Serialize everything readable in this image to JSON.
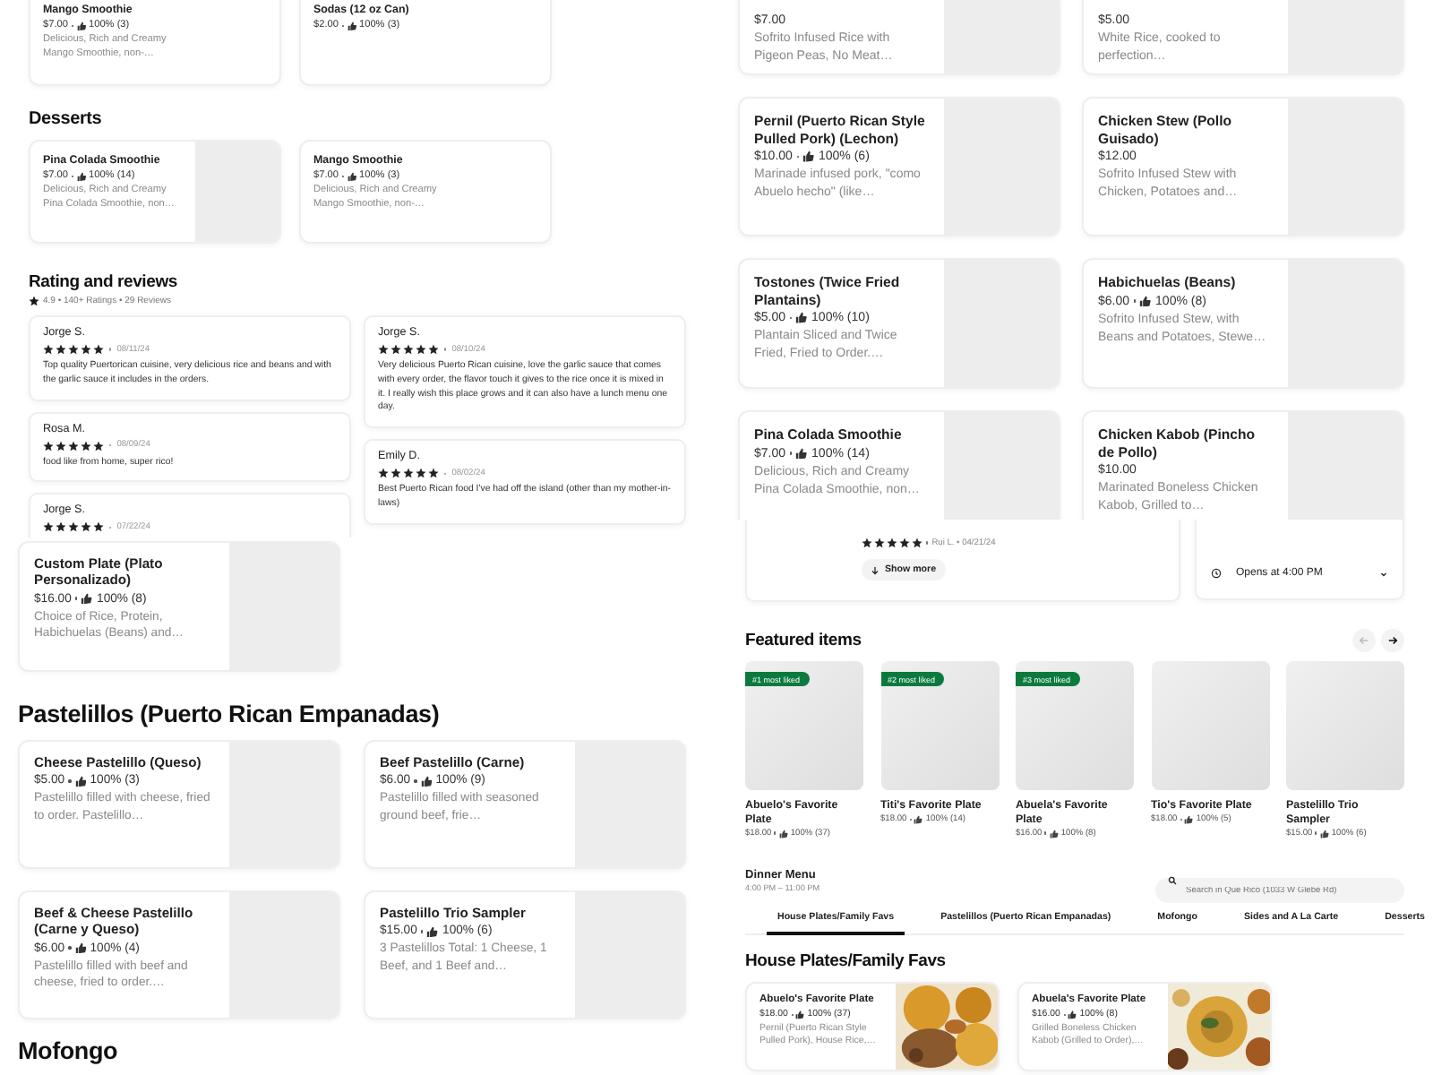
{
  "top_left": {
    "items": [
      {
        "name": "Mango Smoothie",
        "price": "$7.00",
        "rating": "100% (3)",
        "description": "Delicious, Rich and Creamy Mango Smoothie, non-…",
        "image": false
      },
      {
        "name": "Sodas (12 oz Can)",
        "price": "$2.00",
        "rating": "100% (3)",
        "image": false
      }
    ],
    "sections": [
      {
        "title": "Desserts",
        "items": [
          {
            "name": "Pina Colada Smoothie",
            "price": "$7.00",
            "rating": "100% (14)",
            "description": "Delicious, Rich and Creamy Pina Colada Smoothie, non…",
            "image": true
          },
          {
            "name": "Mango Smoothie",
            "price": "$7.00",
            "rating": "100% (3)",
            "description": "Delicious, Rich and Creamy Mango Smoothie, non-…",
            "image": false
          }
        ]
      }
    ],
    "reviews": {
      "title": "Rating and reviews",
      "summary": "4.9 • 140+ Ratings • 29 Reviews",
      "columns": [
        [
          {
            "author": "Jorge S.",
            "stars": 5,
            "date": "08/11/24",
            "text": "Top quality Puertorican cuisine, very delicious rice and beans and with the garlic sauce it includes in the orders."
          },
          {
            "author": "Rosa M.",
            "stars": 5,
            "date": "08/09/24",
            "text": "food like from home, super rico!"
          },
          {
            "author": "Jorge S.",
            "stars": 5,
            "date": "07/22/24"
          }
        ],
        [
          {
            "author": "Jorge S.",
            "stars": 5,
            "date": "08/10/24",
            "text": "Very delicious Puerto Rican cuisine, love the garlic sauce that comes with every order, the flavor touch it gives to the rice once it is mixed in it. I really wish this place grows and it can also have a lunch menu one day."
          },
          {
            "author": "Emily D.",
            "stars": 5,
            "date": "08/02/24",
            "text": "Best Puerto Rican food I've had off the island (other than my mother-in-laws)"
          }
        ]
      ]
    }
  },
  "bottom_left": {
    "items": [
      {
        "name": "Custom Plate (Plato Personalizado)",
        "price": "$16.00",
        "rating": "100% (8)",
        "description": "Choice of Rice, Protein, Habichuelas (Beans) and…"
      }
    ],
    "sections": [
      {
        "title": "Pastelillos (Puerto Rican Empanadas)",
        "items": [
          {
            "name": "Cheese Pastelillo (Queso)",
            "price": "$5.00",
            "rating": "100% (3)",
            "description": "Pastelillo filled with cheese, fried to order. Pastelillo…"
          },
          {
            "name": "Beef Pastelillo (Carne)",
            "price": "$6.00",
            "rating": "100% (9)",
            "description": "Pastelillo filled with seasoned ground beef, frie…"
          },
          {
            "name": "Beef & Cheese Pastelillo (Carne y Queso)",
            "price": "$6.00",
            "rating": "100% (4)",
            "description": "Pastelillo filled with beef and cheese, fried to order.…"
          },
          {
            "name": "Pastelillo Trio Sampler",
            "price": "$15.00",
            "rating": "100% (6)",
            "description": "3 Pastelillos Total: 1 Cheese, 1 Beef, and 1 Beef and…"
          }
        ]
      },
      {
        "title": "Mofongo"
      }
    ]
  },
  "top_right": {
    "items": [
      {
        "price": "$7.00",
        "description": "Sofrito Infused Rice with Pigeon Peas, No Meat…"
      },
      {
        "price": "$5.00",
        "description": "White Rice, cooked to perfection…"
      },
      {
        "name": "Pernil (Puerto Rican Style Pulled Pork) (Lechon)",
        "price": "$10.00",
        "rating": "100% (6)",
        "description": "Marinade infused pork, \"como Abuelo hecho\" (like…"
      },
      {
        "name": "Chicken Stew (Pollo Guisado)",
        "price": "$12.00",
        "description": "Sofrito Infused Stew with Chicken, Potatoes and…"
      },
      {
        "name": "Tostones (Twice Fried Plantains)",
        "price": "$5.00",
        "rating": "100% (10)",
        "description": "Plantain Sliced and Twice Fried, Fried to Order.…"
      },
      {
        "name": "Habichuelas (Beans)",
        "price": "$6.00",
        "rating": "100% (8)",
        "description": "Sofrito Infused Stew, with Beans and Potatoes, Stewe…"
      },
      {
        "name": "Pina Colada Smoothie",
        "price": "$7.00",
        "rating": "100% (14)",
        "description": "Delicious, Rich and Creamy Pina Colada Smoothie, non…"
      },
      {
        "name": "Chicken Kabob (Pincho de Pollo)",
        "price": "$10.00",
        "description": "Marinated Boneless Chicken Kabob, Grilled to…"
      }
    ]
  },
  "bottom_right": {
    "review": {
      "stars": 5,
      "meta": "Rui L. • 04/21/24",
      "button": "Show more"
    },
    "hours": {
      "label": "Opens at 4:00 PM"
    },
    "featured": {
      "title": "Featured items",
      "arrows": [
        {
          "kind": "prev",
          "disabled": true
        },
        {
          "kind": "next",
          "disabled": false
        }
      ],
      "items": [
        {
          "badge": "#1 most liked",
          "name": "Abuelo's Favorite Plate",
          "price": "$18.00",
          "rating": "100% (37)"
        },
        {
          "badge": "#2 most liked",
          "name": "Titi's Favorite Plate",
          "price": "$18.00",
          "rating": "100% (14)"
        },
        {
          "badge": "#3 most liked",
          "name": "Abuela's Favorite Plate",
          "price": "$16.00",
          "rating": "100% (8)"
        },
        {
          "name": "Tio's Favorite Plate",
          "price": "$18.00",
          "rating": "100% (5)"
        },
        {
          "name": "Pastelillo Trio Sampler",
          "price": "$15.00",
          "rating": "100% (6)"
        }
      ]
    },
    "menu": {
      "title": "Dinner Menu",
      "hours": "4:00 PM – 11:00 PM",
      "search": {
        "placeholder": "Search in Que Rico (1033 W Glebe Rd)"
      },
      "tabs": [
        {
          "label": "House Plates/Family Favs",
          "selected": true
        },
        {
          "label": "Pastelillos (Puerto Rican Empanadas)",
          "selected": false
        },
        {
          "label": "Mofongo",
          "selected": false
        },
        {
          "label": "Sides and A La Carte",
          "selected": false
        },
        {
          "label": "Desserts",
          "selected": false
        }
      ],
      "section": "House Plates/Family Favs",
      "items": [
        {
          "name": "Abuelo's Favorite Plate",
          "price": "$18.00",
          "rating": "100% (37)",
          "description": "Pernil (Puerto Rican Style Pulled Pork), House Rice,…",
          "image": true
        },
        {
          "name": "Abuela's Favorite Plate",
          "price": "$16.00",
          "rating": "100% (8)",
          "description": "Grilled Boneless Chicken Kabob (Grilled to Order),…",
          "image": true
        }
      ]
    }
  }
}
